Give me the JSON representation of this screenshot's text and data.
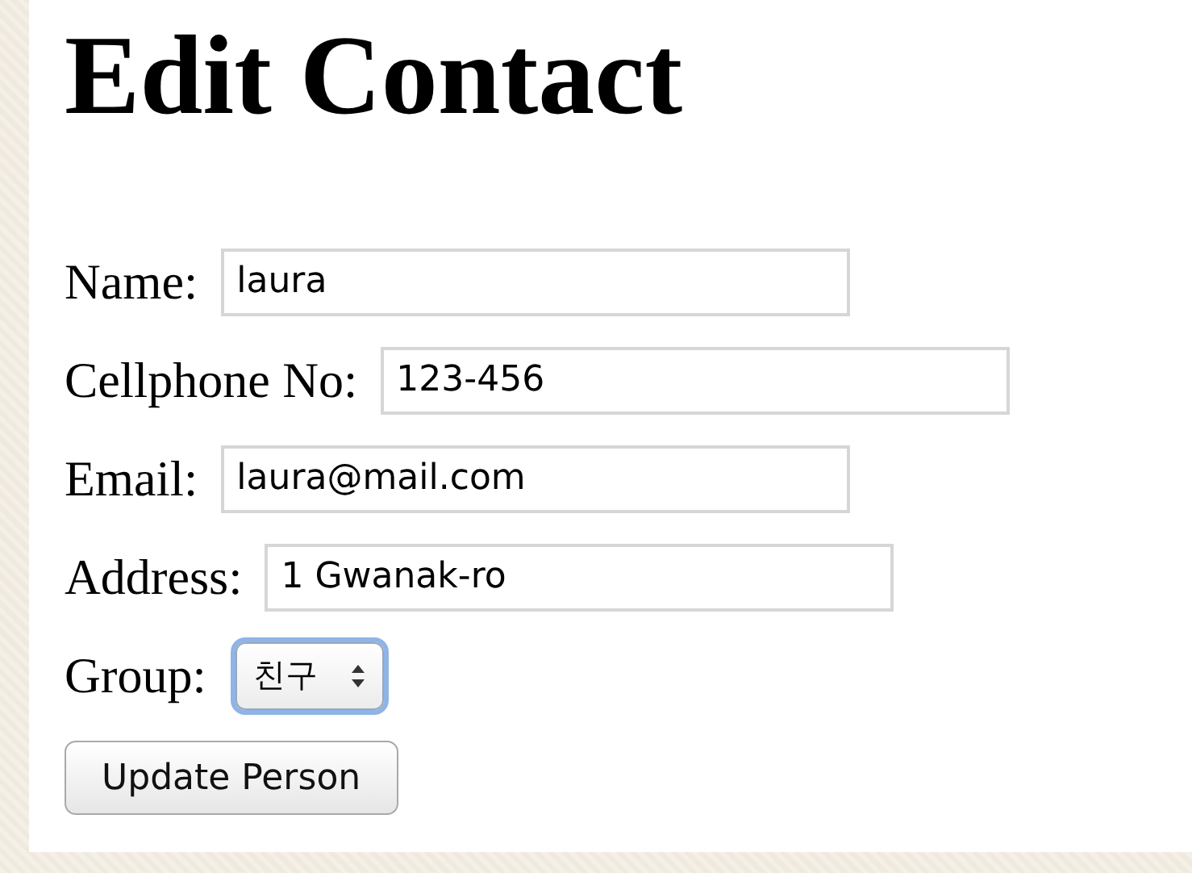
{
  "heading": "Edit Contact",
  "fields": [
    {
      "label": "Name:",
      "value": "laura",
      "kind": "text"
    },
    {
      "label": "Cellphone No:",
      "value": "123-456",
      "kind": "text"
    },
    {
      "label": "Email:",
      "value": "laura@mail.com",
      "kind": "text"
    },
    {
      "label": "Address:",
      "value": "1 Gwanak-ro",
      "kind": "text"
    },
    {
      "label": "Group:",
      "value": "친구",
      "kind": "select"
    }
  ],
  "submit": "Update Person"
}
